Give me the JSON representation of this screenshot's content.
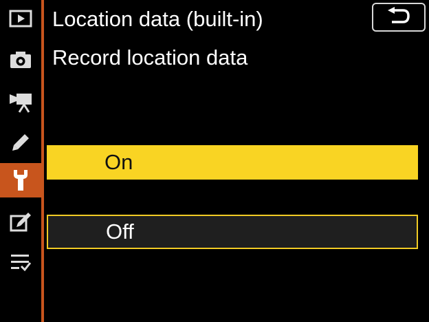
{
  "sidebar": {
    "items": [
      {
        "icon": "playback-icon",
        "active": false
      },
      {
        "icon": "camera-icon",
        "active": false
      },
      {
        "icon": "movie-camera-icon",
        "active": false
      },
      {
        "icon": "pencil-icon",
        "active": false
      },
      {
        "icon": "wrench-icon",
        "active": true
      },
      {
        "icon": "retouch-icon",
        "active": false
      },
      {
        "icon": "my-menu-icon",
        "active": false
      }
    ],
    "accent_color": "#c8551d"
  },
  "header": {
    "title": "Location data (built-in)",
    "back_icon": "return-icon"
  },
  "main": {
    "subtitle": "Record location data",
    "options": [
      {
        "label": "On",
        "selected": true
      },
      {
        "label": "Off",
        "selected": false
      }
    ],
    "highlight_color": "#f9d423"
  }
}
